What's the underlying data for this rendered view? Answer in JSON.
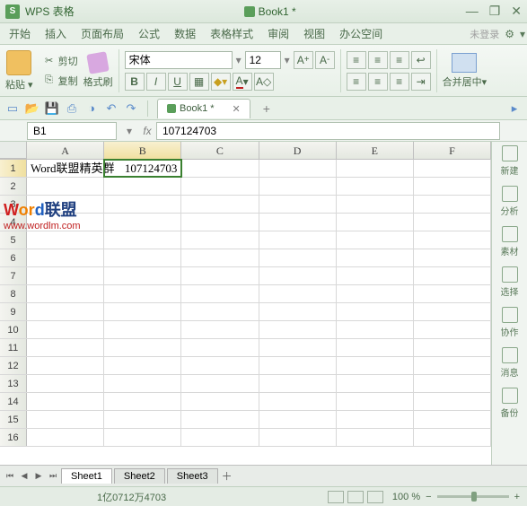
{
  "app": {
    "name": "WPS 表格",
    "document": "Book1 *"
  },
  "window_buttons": {
    "min": "—",
    "restore": "❐",
    "close": "✕"
  },
  "menu": {
    "items": [
      "开始",
      "插入",
      "页面布局",
      "公式",
      "数据",
      "表格样式",
      "审阅",
      "视图",
      "办公空间"
    ],
    "login": "未登录"
  },
  "ribbon": {
    "paste": "粘贴",
    "cut": "剪切",
    "copy": "复制",
    "format_painter": "格式刷",
    "font_name": "宋体",
    "font_size": "12",
    "bold": "B",
    "italic": "I",
    "underline": "U",
    "merge_center": "合并居中"
  },
  "doc_tab": {
    "name": "Book1 *"
  },
  "formula_bar": {
    "name_box": "B1",
    "fx": "fx",
    "value": "107124703"
  },
  "columns": [
    "A",
    "B",
    "C",
    "D",
    "E",
    "F"
  ],
  "rows": [
    1,
    2,
    3,
    4,
    5,
    6,
    7,
    8,
    9,
    10,
    11,
    12,
    13,
    14,
    15,
    16
  ],
  "cells": {
    "A1": "Word联盟精英群",
    "B1": "107124703"
  },
  "active_cell": "B1",
  "watermark": {
    "line1_head": "Word",
    "line1_tail": "联盟",
    "line2": "www.wordlm.com"
  },
  "sidepanel": [
    "新建",
    "分析",
    "素材",
    "选择",
    "协作",
    "消息",
    "备份"
  ],
  "sheets": [
    "Sheet1",
    "Sheet2",
    "Sheet3"
  ],
  "statusbar": {
    "text": "1亿0712万4703",
    "zoom": "100 %"
  }
}
